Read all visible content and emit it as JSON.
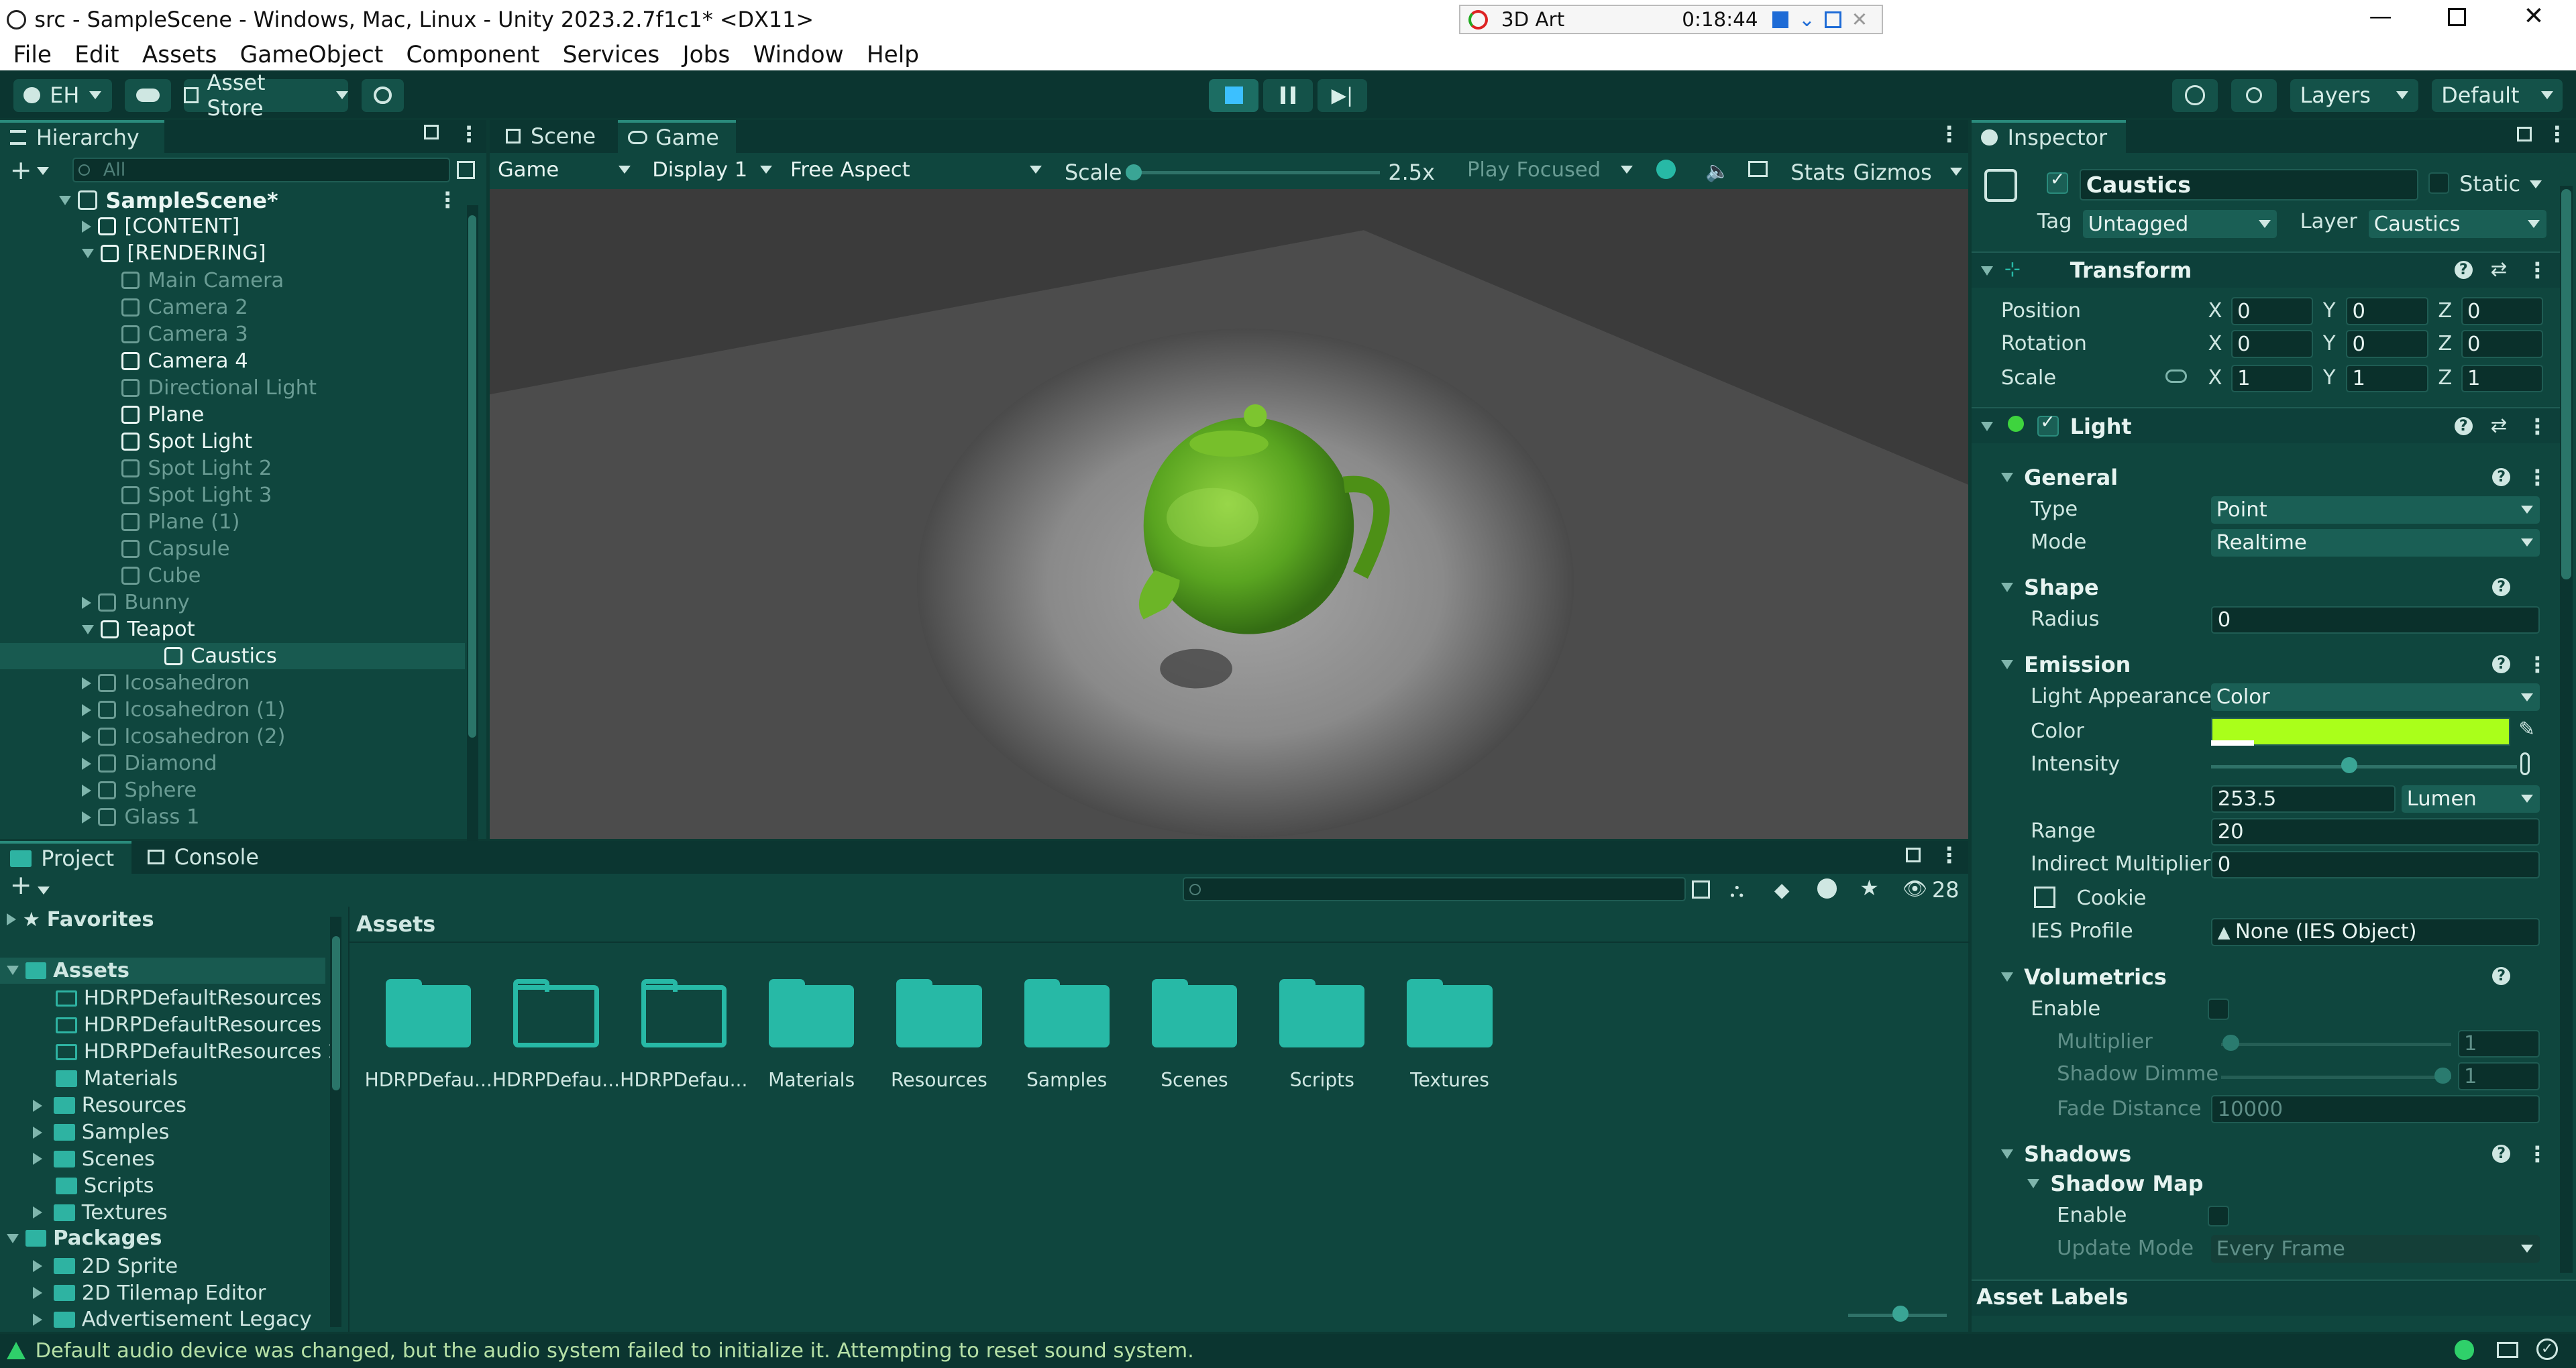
{
  "window": {
    "title": "src - SampleScene - Windows, Mac, Linux - Unity 2023.2.7f1c1* <DX11>",
    "recorder_label": "3D Art",
    "recorder_time": "0:18:44"
  },
  "menu": [
    "File",
    "Edit",
    "Assets",
    "GameObject",
    "Component",
    "Services",
    "Jobs",
    "Window",
    "Help"
  ],
  "toolbar": {
    "account": "EH",
    "asset_store": "Asset Store",
    "layers": "Layers",
    "layout": "Default"
  },
  "hierarchy": {
    "tab": "Hierarchy",
    "search_placeholder": "All",
    "scene": "SampleScene*",
    "items": [
      {
        "label": "[CONTENT]"
      },
      {
        "label": "[RENDERING]"
      },
      {
        "label": "Main Camera"
      },
      {
        "label": "Camera 2"
      },
      {
        "label": "Camera 3"
      },
      {
        "label": "Camera 4"
      },
      {
        "label": "Directional Light"
      },
      {
        "label": "Plane"
      },
      {
        "label": "Spot Light"
      },
      {
        "label": "Spot Light 2"
      },
      {
        "label": "Spot Light 3"
      },
      {
        "label": "Plane (1)"
      },
      {
        "label": "Capsule"
      },
      {
        "label": "Cube"
      },
      {
        "label": "Bunny"
      },
      {
        "label": "Teapot"
      },
      {
        "label": "Caustics"
      },
      {
        "label": "Icosahedron"
      },
      {
        "label": "Icosahedron (1)"
      },
      {
        "label": "Icosahedron (2)"
      },
      {
        "label": "Diamond"
      },
      {
        "label": "Sphere"
      },
      {
        "label": "Glass 1"
      }
    ]
  },
  "game": {
    "tabs": [
      "Scene",
      "Game"
    ],
    "view": "Game",
    "display": "Display 1",
    "aspect": "Free Aspect",
    "scale_label": "Scale",
    "scale_value": "2.5x",
    "play_mode": "Play Focused",
    "stats": "Stats",
    "gizmos": "Gizmos"
  },
  "project": {
    "tabs": [
      "Project",
      "Console"
    ],
    "hidden_count": "28",
    "favorites": "Favorites",
    "assets_root": "Assets",
    "tree": [
      "HDRPDefaultResources",
      "HDRPDefaultResources 1",
      "HDRPDefaultResources 2",
      "Materials",
      "Resources",
      "Samples",
      "Scenes",
      "Scripts",
      "Textures"
    ],
    "packages": "Packages",
    "package_items": [
      "2D Sprite",
      "2D Tilemap Editor",
      "Advertisement Legacy"
    ],
    "breadcrumb": "Assets",
    "folders": [
      "HDRPDefau...",
      "HDRPDefau...",
      "HDRPDefau...",
      "Materials",
      "Resources",
      "Samples",
      "Scenes",
      "Scripts",
      "Textures"
    ]
  },
  "inspector": {
    "tab": "Inspector",
    "object_name": "Caustics",
    "static_label": "Static",
    "tag_label": "Tag",
    "tag": "Untagged",
    "layer_label": "Layer",
    "layer": "Caustics",
    "transform": {
      "title": "Transform",
      "position_label": "Position",
      "rotation_label": "Rotation",
      "scale_label": "Scale",
      "position": [
        "0",
        "0",
        "0"
      ],
      "rotation": [
        "0",
        "0",
        "0"
      ],
      "scale": [
        "1",
        "1",
        "1"
      ],
      "axes": [
        "X",
        "Y",
        "Z"
      ]
    },
    "light": {
      "title": "Light",
      "general": "General",
      "type_label": "Type",
      "type": "Point",
      "mode_label": "Mode",
      "mode": "Realtime",
      "shape": "Shape",
      "radius_label": "Radius",
      "radius": "0",
      "emission": "Emission",
      "appearance_label": "Light Appearance",
      "appearance": "Color",
      "color_label": "Color",
      "color": "#aaff1a",
      "intensity_label": "Intensity",
      "intensity": "253.5",
      "intensity_unit": "Lumen",
      "range_label": "Range",
      "range": "20",
      "indirect_label": "Indirect Multiplier",
      "indirect": "0",
      "cookie_label": "Cookie",
      "ies_label": "IES Profile",
      "ies": "None (IES Object)",
      "volumetrics": "Volumetrics",
      "enable_label": "Enable",
      "multiplier_label": "Multiplier",
      "multiplier": "1",
      "shadow_dimmer_label": "Shadow Dimme",
      "shadow_dimmer": "1",
      "fade_label": "Fade Distance",
      "fade": "10000",
      "shadows": "Shadows",
      "shadow_map": "Shadow Map",
      "shadow_enable_label": "Enable",
      "update_mode_label": "Update Mode",
      "update_mode": "Every Frame"
    },
    "asset_labels": "Asset Labels"
  },
  "status": {
    "message": "Default audio device was changed, but the audio system failed to initialize it. Attempting to reset sound system."
  }
}
